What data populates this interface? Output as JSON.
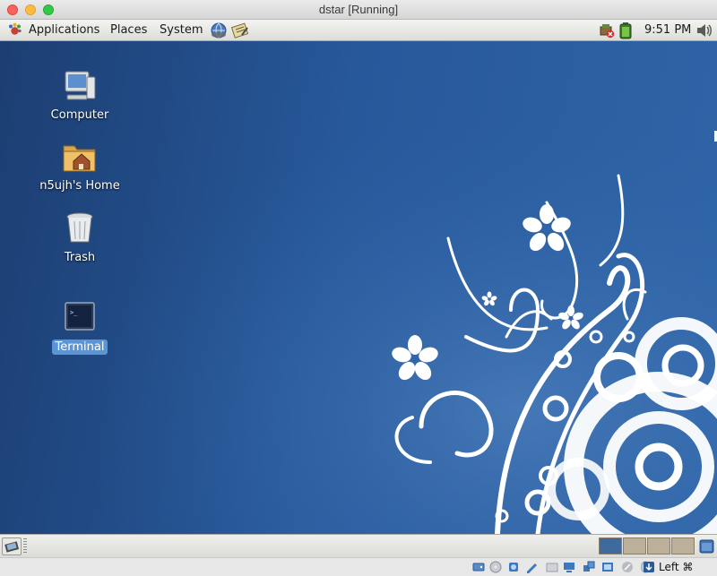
{
  "window": {
    "title": "dstar [Running]"
  },
  "top_panel": {
    "menus": [
      "Applications",
      "Places",
      "System"
    ],
    "clock": "9:51 PM",
    "icons": [
      "gnome-foot-icon",
      "network-browser-icon",
      "text-editor-icon",
      "software-update-alert-icon",
      "battery-icon",
      "volume-icon"
    ]
  },
  "desktop": {
    "icons": [
      {
        "label": "Computer",
        "icon": "computer-icon",
        "selected": false
      },
      {
        "label": "n5ujh's Home",
        "icon": "home-folder-icon",
        "selected": false
      },
      {
        "label": "Trash",
        "icon": "trash-icon",
        "selected": false
      },
      {
        "label": "Terminal",
        "icon": "terminal-icon",
        "selected": true
      }
    ],
    "wallpaper": {
      "base_color": "#27589a",
      "ornament_color": "#ffffff"
    }
  },
  "bottom_panel": {
    "workspaces": 4,
    "active_workspace": 1,
    "active_color": "#3e6a9e",
    "inactive_color": "#bcb09a"
  },
  "vbox_status": {
    "host_key": "Left ⌘",
    "icons": [
      "hard-disk-icon",
      "optical-drive-icon",
      "audio-icon",
      "network-icon",
      "usb-icon",
      "shared-folders-icon",
      "display-icon",
      "video-capture-icon",
      "vt-x-icon",
      "mouse-integration-icon",
      "host-key-arrow-icon"
    ]
  }
}
